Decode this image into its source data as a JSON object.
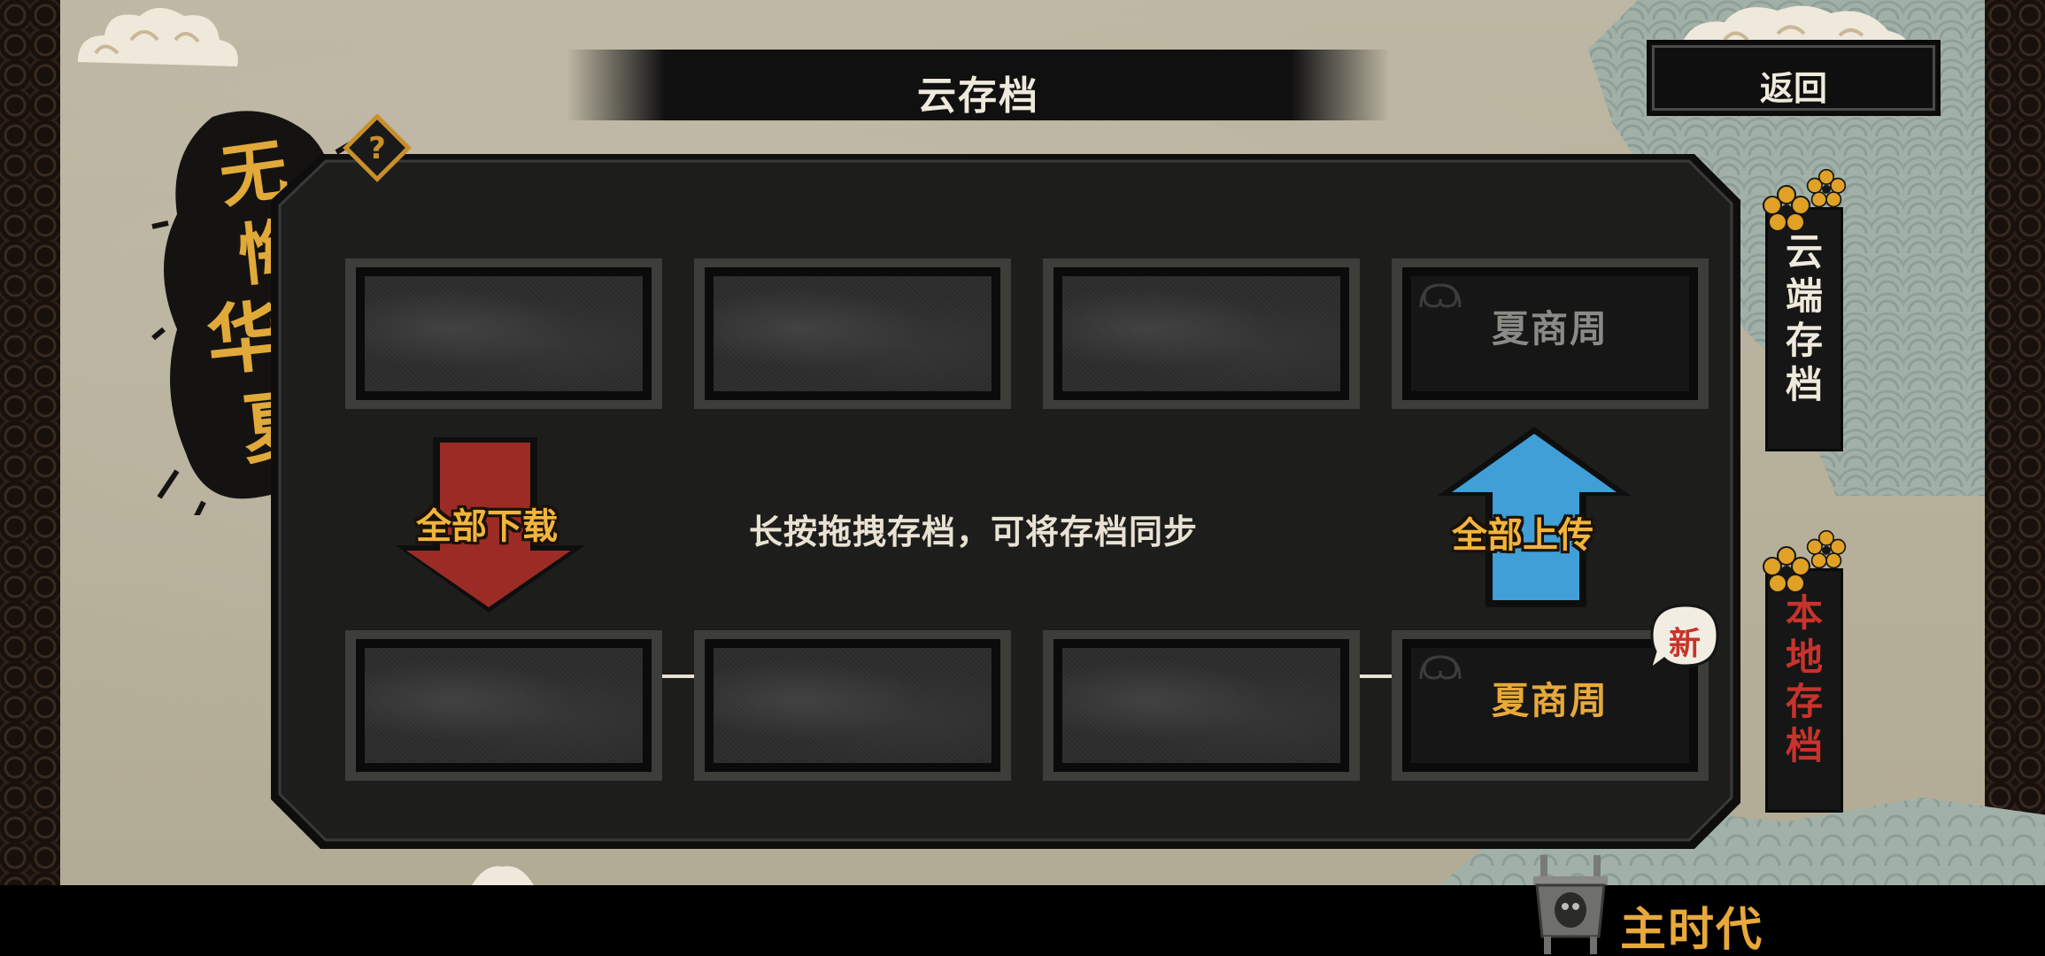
{
  "header": {
    "title": "云存档",
    "back_label": "返回"
  },
  "logo": {
    "text": "无悔华夏"
  },
  "hint": {
    "text": "长按拖拽存档，可将存档同步"
  },
  "actions": {
    "download_all": "全部下载",
    "upload_all": "全部上传"
  },
  "cloud_slots": [
    {
      "label": ""
    },
    {
      "label": ""
    },
    {
      "label": ""
    },
    {
      "label": "夏商周"
    }
  ],
  "local_slots": [
    {
      "label": ""
    },
    {
      "label": ""
    },
    {
      "label": ""
    },
    {
      "label": "夏商周"
    }
  ],
  "new_badge": "新",
  "side_tabs": {
    "cloud": "云端存档",
    "local": "本地存档"
  },
  "footer": {
    "era": "主时代"
  },
  "colors": {
    "accent_gold": "#f2b43b",
    "download_red": "#9c2b26",
    "upload_blue": "#3f9fd6",
    "local_tab_red": "#c8332b",
    "cloud_slot_text": "#8a8a86"
  }
}
